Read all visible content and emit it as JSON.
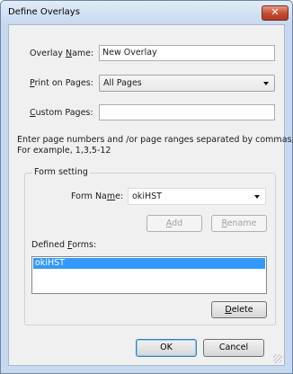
{
  "window": {
    "title": "Define Overlays",
    "close_glyph": "✕"
  },
  "overlay_name": {
    "label_before": "Overlay ",
    "label_mnemonic": "N",
    "label_after": "ame:",
    "value": "New Overlay"
  },
  "print_on_pages": {
    "label_mnemonic": "P",
    "label_after": "rint on Pages:",
    "selected": "All Pages"
  },
  "custom_pages": {
    "label_mnemonic": "C",
    "label_after": "ustom Pages:",
    "value": ""
  },
  "help_text": {
    "line1": "Enter page numbers and /or page ranges separated by commas,",
    "line2": "For example, 1,3,5-12"
  },
  "form_setting": {
    "group_title": "Form setting",
    "form_name_label": "Form Na",
    "form_name_mnemonic": "m",
    "form_name_label_after": "e:",
    "form_name_selected": "okiHST",
    "add_mnemonic": "A",
    "add_after": "dd",
    "rename_mnemonic": "R",
    "rename_after": "ename",
    "defined_forms_label": "Defined ",
    "defined_forms_mnemonic": "F",
    "defined_forms_after": "orms:",
    "defined_forms": [
      "okiHST"
    ],
    "delete_mnemonic": "D",
    "delete_after": "elete"
  },
  "footer": {
    "ok_label": "OK",
    "cancel_label": "Cancel"
  },
  "colors": {
    "selection": "#3399ff",
    "title_bar": "#c6d9ef",
    "close_button": "#c24a32"
  }
}
